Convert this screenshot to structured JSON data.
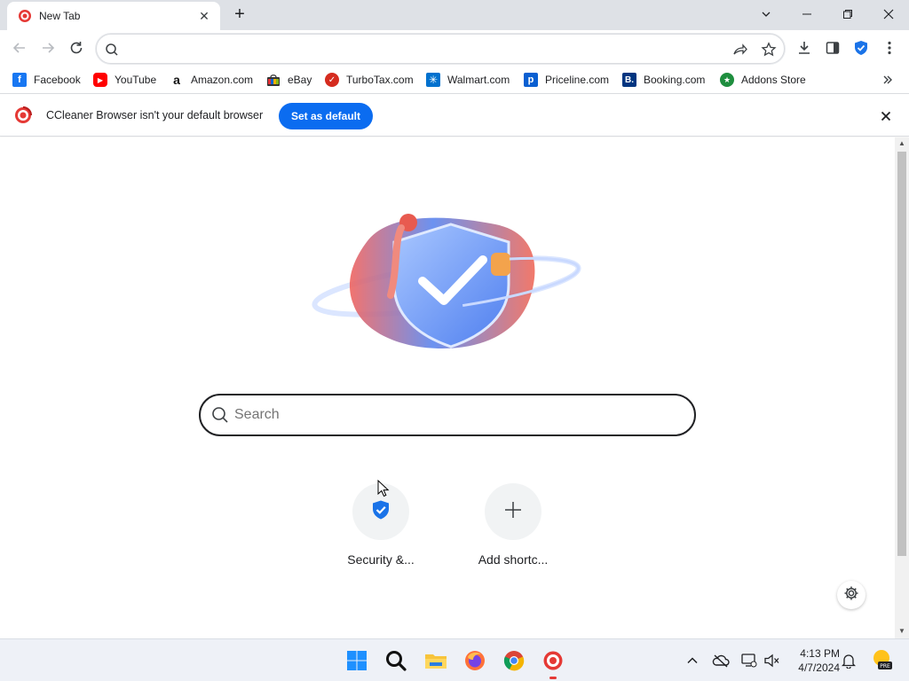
{
  "tab": {
    "title": "New Tab",
    "close_icon": "close-icon"
  },
  "window": {
    "controls": [
      "chevron-down-icon",
      "minimize-icon",
      "restore-icon",
      "close-icon"
    ]
  },
  "toolbar": {
    "omnibox_value": "",
    "omnibox_placeholder": ""
  },
  "bookmarks": [
    {
      "label": "Facebook",
      "icon": "facebook-icon",
      "color": "#1877f2"
    },
    {
      "label": "YouTube",
      "icon": "youtube-icon",
      "color": "#ff0000"
    },
    {
      "label": "Amazon.com",
      "icon": "amazon-icon",
      "color": "#111111"
    },
    {
      "label": "eBay",
      "icon": "ebay-icon",
      "color": "#e53238"
    },
    {
      "label": "TurboTax.com",
      "icon": "turbotax-icon",
      "color": "#d52b1e"
    },
    {
      "label": "Walmart.com",
      "icon": "walmart-icon",
      "color": "#0071ce"
    },
    {
      "label": "Priceline.com",
      "icon": "priceline-icon",
      "color": "#0a5fd1"
    },
    {
      "label": "Booking.com",
      "icon": "booking-icon",
      "color": "#003580"
    },
    {
      "label": "Addons Store",
      "icon": "addons-store-icon",
      "color": "#1e8e3e"
    }
  ],
  "infobar": {
    "message": "CCleaner Browser isn't your default browser",
    "button": "Set as default",
    "accent": "#0b6cf0"
  },
  "ntp": {
    "search_placeholder": "Search",
    "shortcuts": [
      {
        "label": "Security &...",
        "icon": "shield-check-icon"
      },
      {
        "label": "Add shortc...",
        "icon": "plus-icon"
      }
    ]
  },
  "taskbar": {
    "apps": [
      "windows-start-icon",
      "search-icon",
      "file-explorer-icon",
      "firefox-icon",
      "chrome-icon",
      "ccleaner-browser-icon"
    ],
    "time": "4:13 PM",
    "date": "4/7/2024"
  }
}
